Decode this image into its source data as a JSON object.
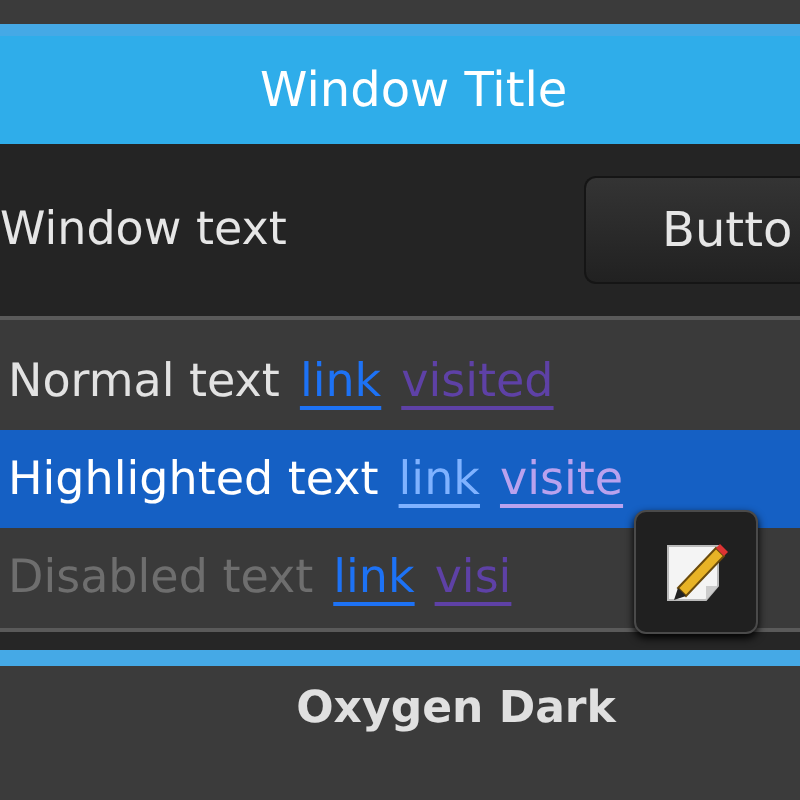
{
  "window": {
    "title": "Window Title",
    "text": "Window text",
    "button": "Butto"
  },
  "view": {
    "rows": [
      {
        "kind": "normal",
        "text": "Normal text",
        "link": "link",
        "visited": "visited"
      },
      {
        "kind": "highlighted",
        "text": "Highlighted text",
        "link": "link",
        "visited": "visite"
      },
      {
        "kind": "disabled",
        "text": "Disabled text",
        "link": "link",
        "visited": "visi"
      }
    ]
  },
  "scheme_name": "Oxygen Dark"
}
